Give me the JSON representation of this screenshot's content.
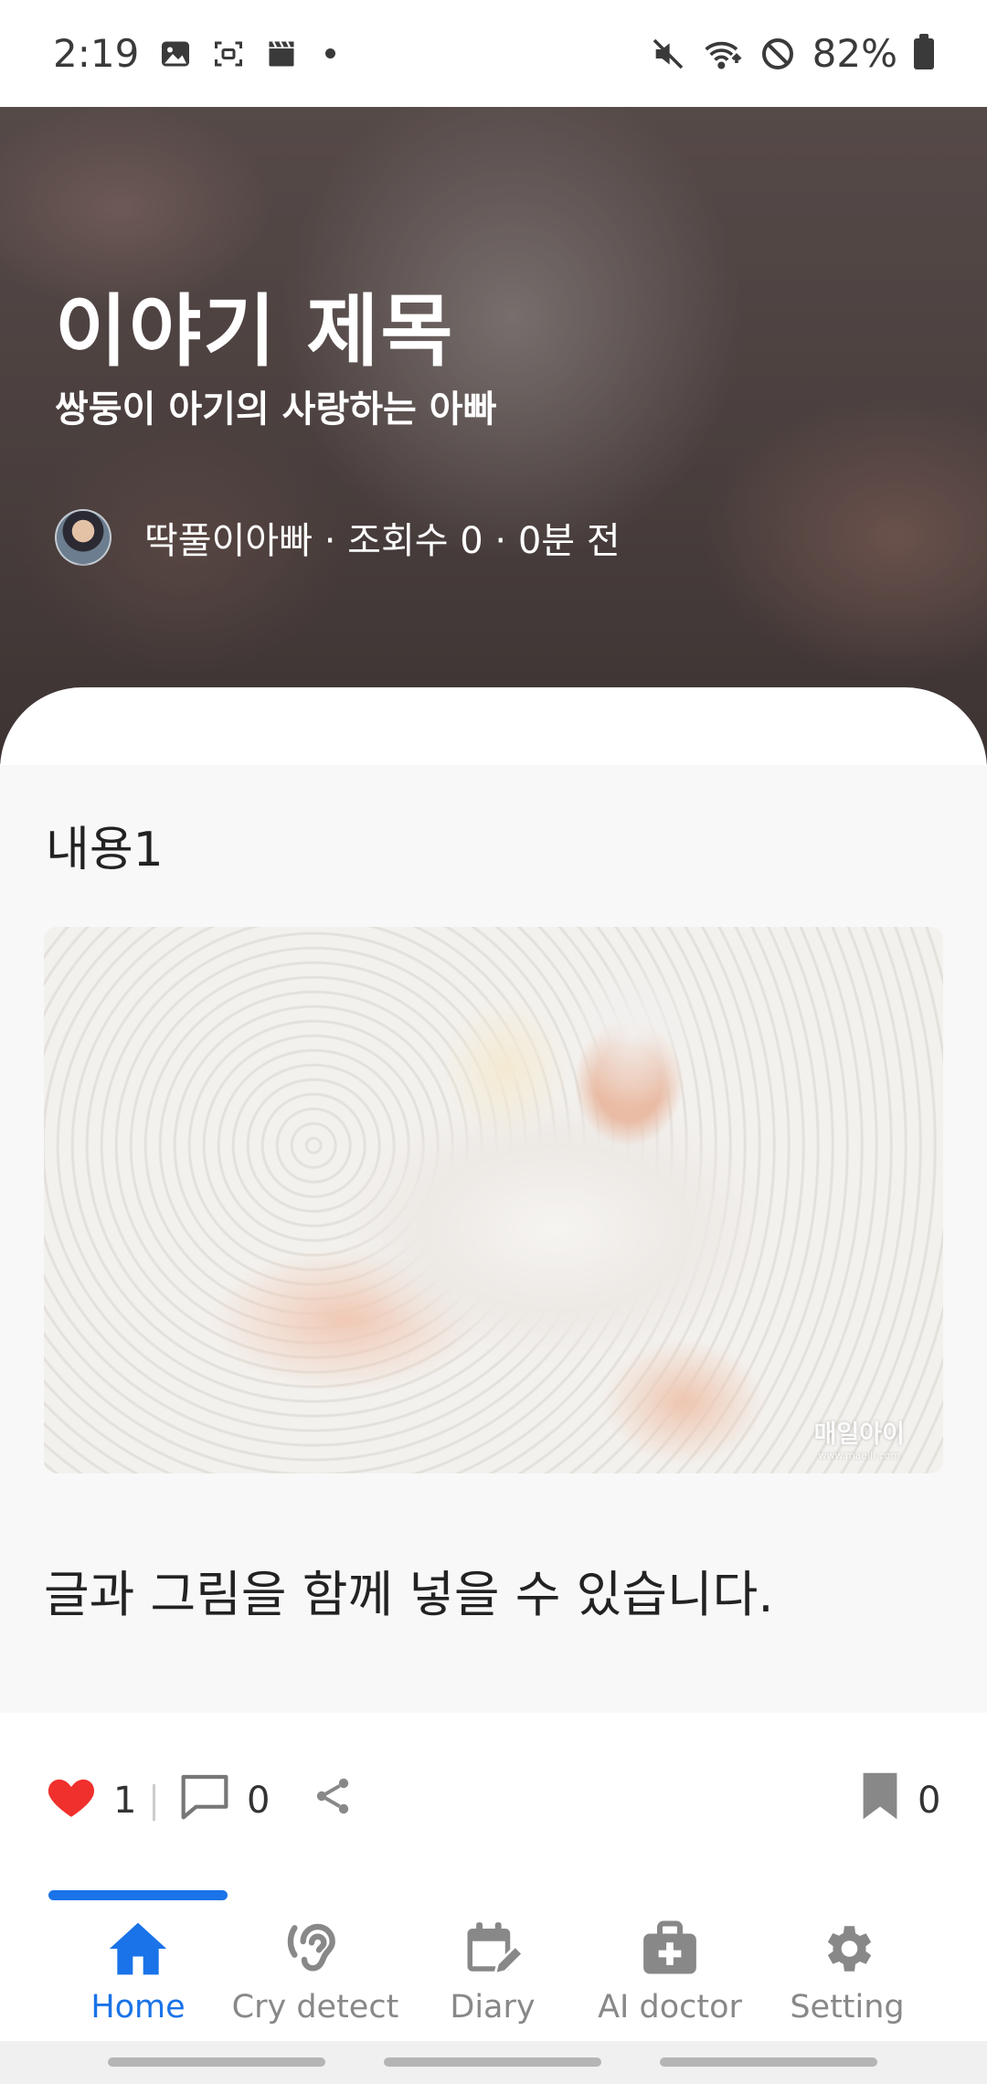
{
  "status_bar": {
    "time": "2:19",
    "battery": "82%",
    "left_icons": [
      "image-icon",
      "screenshot-icon",
      "clapperboard-icon",
      "dot-icon"
    ],
    "right_icons": [
      "mute-icon",
      "wifi-icon",
      "no-disturb-icon",
      "battery-icon"
    ]
  },
  "hero": {
    "title": "이야기 제목",
    "subtitle": "쌍둥이 아기의 사랑하는 아빠",
    "meta": "딱풀이아빠 · 조회수 0 · 0분 전"
  },
  "content": {
    "section_label": "내용1",
    "watermark": "매일아이",
    "watermark_url": "www.maeili.com",
    "body_text": "글과 그림을 함께 넣을 수 있습니다."
  },
  "actions": {
    "like_count": "1",
    "comment_count": "0",
    "bookmark_count": "0",
    "separator": "|"
  },
  "bottom_nav": {
    "items": [
      {
        "label": "Home",
        "icon": "home-icon",
        "active": true
      },
      {
        "label": "Cry detect",
        "icon": "ear-icon",
        "active": false
      },
      {
        "label": "Diary",
        "icon": "calendar-edit-icon",
        "active": false
      },
      {
        "label": "AI doctor",
        "icon": "medical-kit-icon",
        "active": false
      },
      {
        "label": "Setting",
        "icon": "gear-icon",
        "active": false
      }
    ]
  },
  "colors": {
    "accent": "#1a73e8",
    "heart": "#f0302c",
    "inactive": "#888888"
  }
}
